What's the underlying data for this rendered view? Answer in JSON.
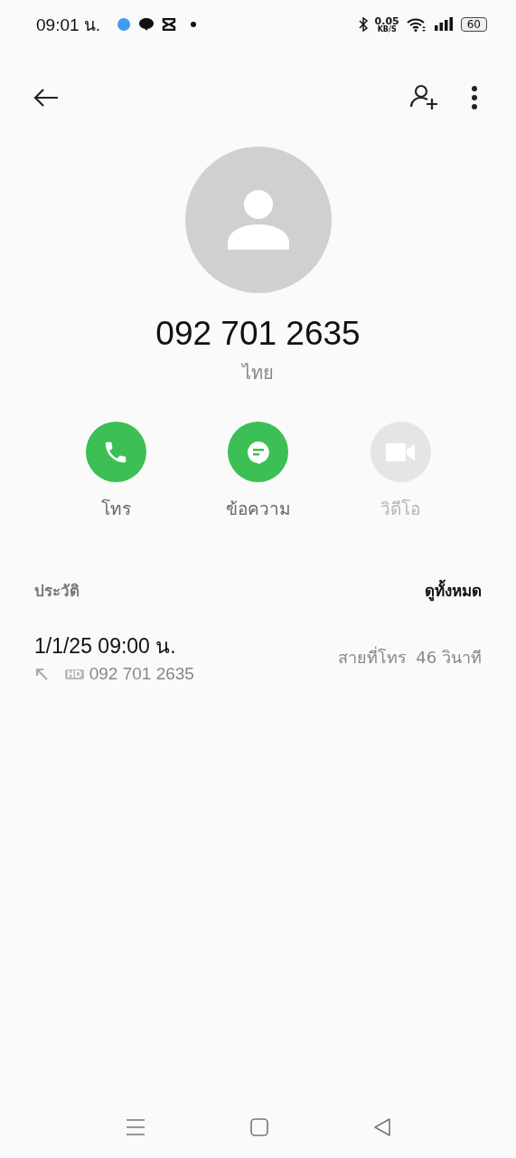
{
  "status_bar": {
    "time": "09:01 น.",
    "net_speed": "0.05",
    "net_unit": "KB/S",
    "battery": "60"
  },
  "contact": {
    "number": "092 701 2635",
    "region": "ไทย"
  },
  "actions": [
    {
      "kind": "call",
      "label": "โทร",
      "disabled": false
    },
    {
      "kind": "message",
      "label": "ข้อความ",
      "disabled": false
    },
    {
      "kind": "video",
      "label": "วิดีโอ",
      "disabled": true
    }
  ],
  "history": {
    "title": "ประวัติ",
    "see_all": "ดูทั้งหมด",
    "entries": [
      {
        "datetime": "1/1/25 09:00 น.",
        "badge": "HD",
        "number": "092 701 2635",
        "type": "สายที่โทร",
        "duration": "46 วินาที"
      }
    ]
  }
}
